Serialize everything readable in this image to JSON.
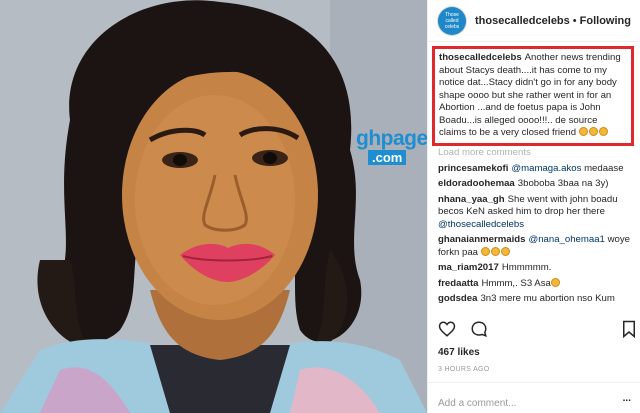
{
  "post": {
    "username": "thosecalledcelebs",
    "separator": "•",
    "follow_status": "Following",
    "avatar_text": "Those called celebs",
    "watermark_g": "ghpage",
    "watermark_com": ".com",
    "caption": "Another news trending about Stacys death....it has come to my notice dat...Stacy didn't go in for any body shape oooo but she rather went in for an Abortion ...and de foetus papa is John Boadu...is alleged oooo!!!.. de source claims to be a very closed friend",
    "load_more": "Load more comments",
    "likes": "467 likes",
    "timestamp": "3 HOURS AGO",
    "add_comment_placeholder": "Add a comment...",
    "more_options": "..."
  },
  "comments": [
    {
      "user": "princesamekofi",
      "mention": "@mamaga.akos",
      "text": "medaase"
    },
    {
      "user": "eldoradoohemaa",
      "mention": "",
      "text": "3boboba 3baa na 3y)"
    },
    {
      "user": "nhana_yaa_gh",
      "mention": "",
      "text": "She went with john boadu becos KeN asked him to drop her there",
      "mention_after": "@thosecalledcelebs"
    },
    {
      "user": "ghanaianmermaids",
      "mention": "@nana_ohemaa1",
      "text": "woye forkn paa"
    },
    {
      "user": "ma_riam2017",
      "mention": "",
      "text": "Hmmmmm."
    },
    {
      "user": "fredaatta",
      "mention": "",
      "text": "Hmmm,. S3 Asa"
    },
    {
      "user": "godsdea",
      "mention": "",
      "text": "3n3 mere mu abortion nso Kum"
    }
  ],
  "colors": {
    "highlight_border": "#e0282f",
    "mention": "#003569",
    "brand": "#1e8ed0"
  },
  "icons": [
    "heart-icon",
    "comment-icon",
    "bookmark-icon",
    "laughing-emoji-icon"
  ]
}
